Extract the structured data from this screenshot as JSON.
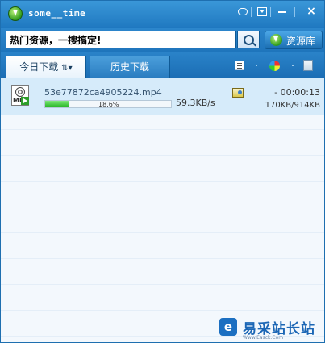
{
  "window": {
    "title": "some__time"
  },
  "search": {
    "value": "热门资源，一搜搞定!",
    "resource_label": "资源库"
  },
  "tabs": [
    {
      "label": "今日下载",
      "suffix": "⇅▾",
      "active": true
    },
    {
      "label": "历史下载",
      "active": false
    }
  ],
  "downloads": [
    {
      "filename": "53e77872ca4905224.mp4",
      "icon_label": "MP",
      "progress": 18.6,
      "progress_label": "18.6%",
      "speed": "59.3KB/s",
      "time_remaining": "- 00:00:13",
      "size": "170KB/914KB"
    }
  ],
  "watermark": {
    "logo_glyph": "e",
    "text": "易采站长站",
    "sub": "Www.Easck.Com"
  },
  "colors": {
    "titlebar": "#1f78c0",
    "progress": "#21b21e",
    "selected_row": "#d6ebfa"
  }
}
